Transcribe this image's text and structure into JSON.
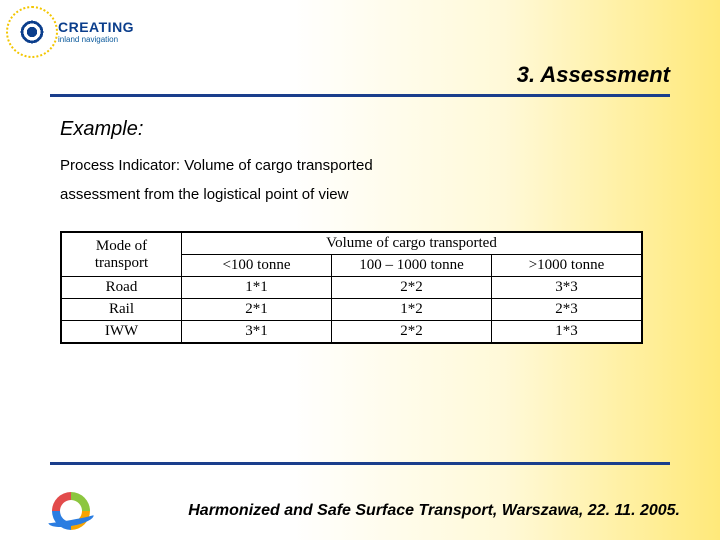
{
  "logo": {
    "word": "CREATING",
    "sub": "inland navigation"
  },
  "header": {
    "title": "3. Assessment"
  },
  "body": {
    "example_label": "Example:",
    "line1": "Process Indicator: Volume of cargo transported",
    "line2": "assessment from the logistical point of view"
  },
  "chart_data": {
    "type": "table",
    "row_header": "Mode of transport",
    "group_header": "Volume of cargo transported",
    "columns": [
      "<100 tonne",
      "100 – 1000 tonne",
      ">1000 tonne"
    ],
    "rows": [
      {
        "name": "Road",
        "cells": [
          "1*1",
          "2*2",
          "3*3"
        ]
      },
      {
        "name": "Rail",
        "cells": [
          "2*1",
          "1*2",
          "2*3"
        ]
      },
      {
        "name": "IWW",
        "cells": [
          "3*1",
          "2*2",
          "1*3"
        ]
      }
    ]
  },
  "footer": {
    "text": "Harmonized and Safe Surface Transport, Warszawa, 22. 11. 2005."
  }
}
